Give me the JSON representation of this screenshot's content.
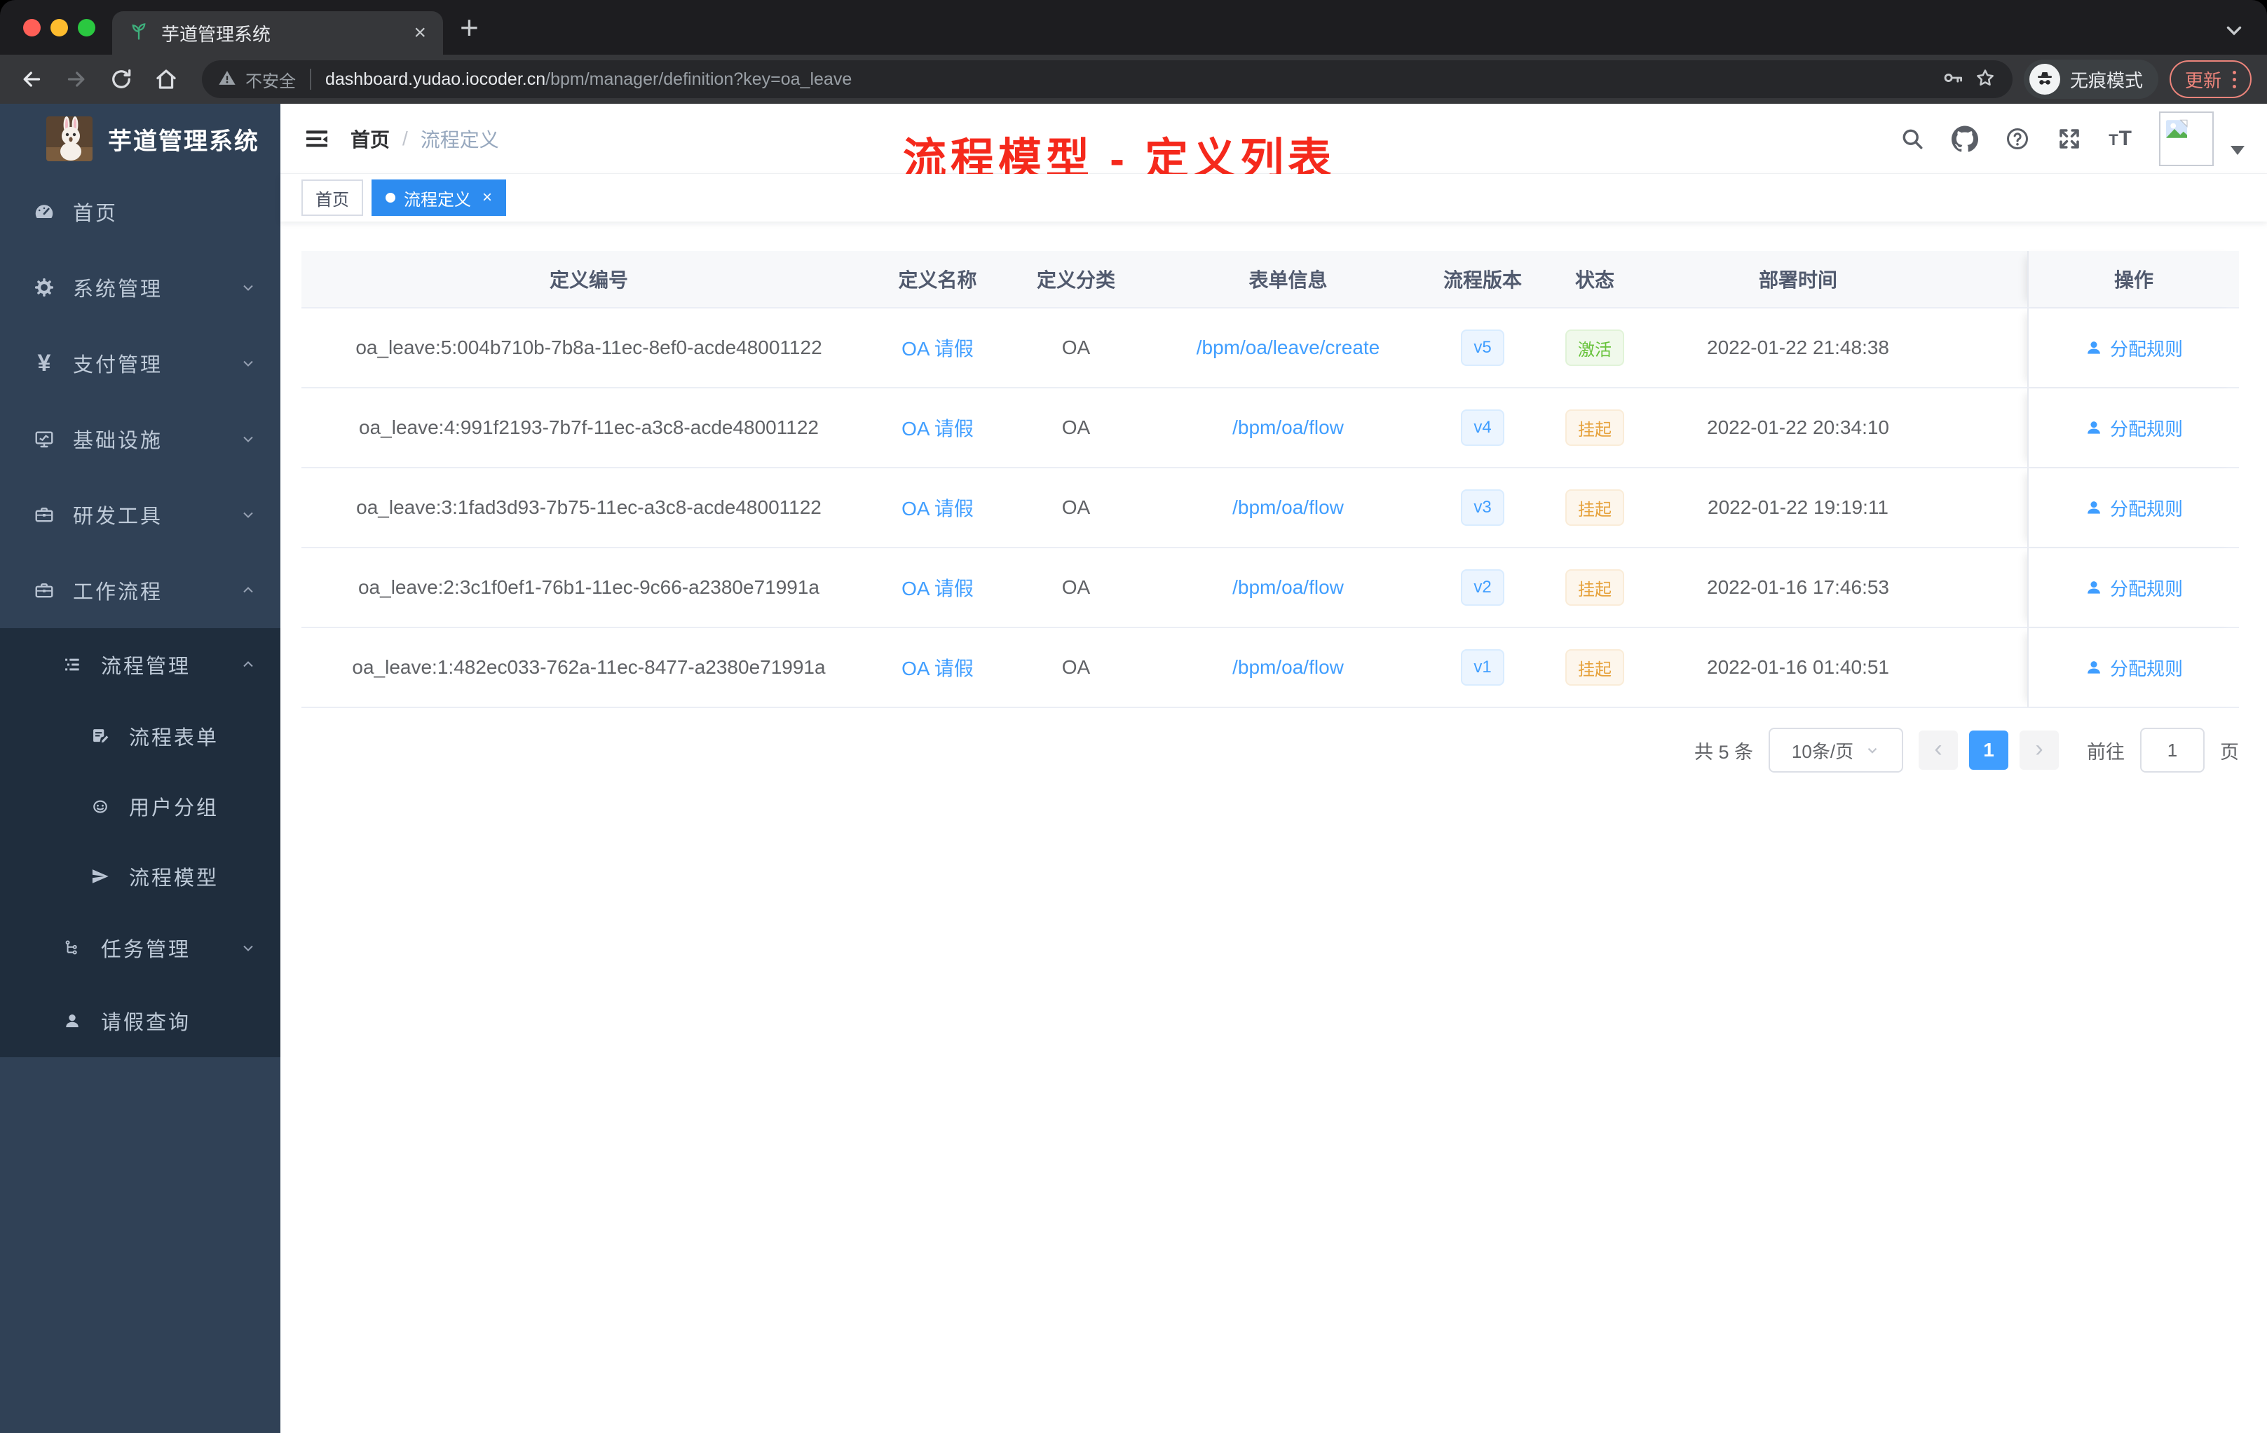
{
  "browser": {
    "tab": {
      "title": "芋道管理系统",
      "close_glyph": "×",
      "new_tab_glyph": "+"
    },
    "address": {
      "security_label": "不安全",
      "url_host": "dashboard.yudao.iocoder.cn",
      "url_path": "/bpm/manager/definition?key=oa_leave"
    },
    "incognito_label": "无痕模式",
    "update_label": "更新"
  },
  "sidebar": {
    "logo_title": "芋道管理系统",
    "items": [
      {
        "label": "首页"
      },
      {
        "label": "系统管理"
      },
      {
        "label": "支付管理"
      },
      {
        "label": "基础设施"
      },
      {
        "label": "研发工具"
      },
      {
        "label": "工作流程"
      }
    ],
    "workflow": {
      "process_mgmt": "流程管理",
      "process_form": "流程表单",
      "user_group": "用户分组",
      "process_model": "流程模型",
      "task_mgmt": "任务管理",
      "leave_query": "请假查询"
    }
  },
  "navbar": {
    "breadcrumb": {
      "root": "首页",
      "separator": "/",
      "current": "流程定义"
    },
    "annotation": "流程模型 - 定义列表",
    "annotation_color": "#f5291c"
  },
  "tags": {
    "inactive": "首页",
    "active": "流程定义",
    "close_glyph": "×"
  },
  "table": {
    "headers": [
      "定义编号",
      "定义名称",
      "定义分类",
      "表单信息",
      "流程版本",
      "状态",
      "部署时间",
      "操作"
    ],
    "rows": [
      {
        "id": "oa_leave:5:004b710b-7b8a-11ec-8ef0-acde48001122",
        "name": "OA 请假",
        "category": "OA",
        "form": "/bpm/oa/leave/create",
        "version": "v5",
        "status": "激活",
        "time": "2022-01-22 21:48:38",
        "action": "分配规则"
      },
      {
        "id": "oa_leave:4:991f2193-7b7f-11ec-a3c8-acde48001122",
        "name": "OA 请假",
        "category": "OA",
        "form": "/bpm/oa/flow",
        "version": "v4",
        "status": "挂起",
        "time": "2022-01-22 20:34:10",
        "action": "分配规则"
      },
      {
        "id": "oa_leave:3:1fad3d93-7b75-11ec-a3c8-acde48001122",
        "name": "OA 请假",
        "category": "OA",
        "form": "/bpm/oa/flow",
        "version": "v3",
        "status": "挂起",
        "time": "2022-01-22 19:19:11",
        "action": "分配规则"
      },
      {
        "id": "oa_leave:2:3c1f0ef1-76b1-11ec-9c66-a2380e71991a",
        "name": "OA 请假",
        "category": "OA",
        "form": "/bpm/oa/flow",
        "version": "v2",
        "status": "挂起",
        "time": "2022-01-16 17:46:53",
        "action": "分配规则"
      },
      {
        "id": "oa_leave:1:482ec033-762a-11ec-8477-a2380e71991a",
        "name": "OA 请假",
        "category": "OA",
        "form": "/bpm/oa/flow",
        "version": "v1",
        "status": "挂起",
        "time": "2022-01-16 01:40:51",
        "action": "分配规则"
      }
    ]
  },
  "pagination": {
    "total": "共 5 条",
    "page_size": "10条/页",
    "prev_glyph": "‹",
    "page": "1",
    "next_glyph": "›",
    "goto_prefix": "前往",
    "goto_value": "1",
    "goto_suffix": "页"
  },
  "colors": {
    "primary": "#409eff",
    "success": "#67c23a",
    "warning": "#e6a23c",
    "sidebar_bg": "#304156",
    "submenu_bg": "#1f2d3d",
    "tag_active_bg": "#2d8cf0",
    "update_button": "#ec847b"
  }
}
